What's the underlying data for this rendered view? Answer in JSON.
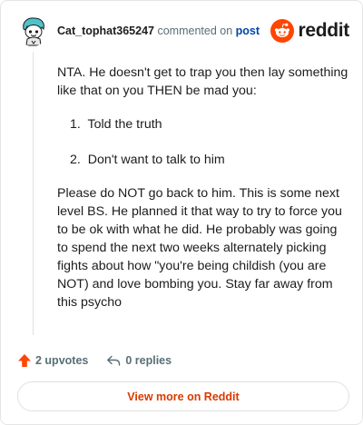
{
  "header": {
    "username": "Cat_tophat365247",
    "commented_text": "commented on",
    "post_link": "post",
    "brand": "reddit"
  },
  "comment": {
    "intro": "NTA. He doesn't get to trap you then lay something like that on you THEN be mad you:",
    "list": [
      {
        "num": "1.",
        "text": "Told the truth"
      },
      {
        "num": "2.",
        "text": "Don't want to talk to him"
      }
    ],
    "closing": "Please do NOT go back to him. This is some next level BS. He planned it that way to try to force you to be ok with what he did. He probably was going to spend the next two weeks alternately picking fights about how \"you're being childish (you are NOT) and love bombing you. Stay far away from this psycho"
  },
  "footer": {
    "upvotes": "2 upvotes",
    "replies": "0 replies",
    "view_more": "View more on Reddit"
  },
  "colors": {
    "accent": "#d93a00",
    "reddit_orange": "#ff4500",
    "meta_gray": "#576f76",
    "link_blue": "#0045ac"
  },
  "icons": {
    "avatar": "snoo-avatar-tophat",
    "brand": "reddit-snoo-icon",
    "upvote": "upvote-arrow-icon",
    "reply": "reply-arrow-icon"
  }
}
